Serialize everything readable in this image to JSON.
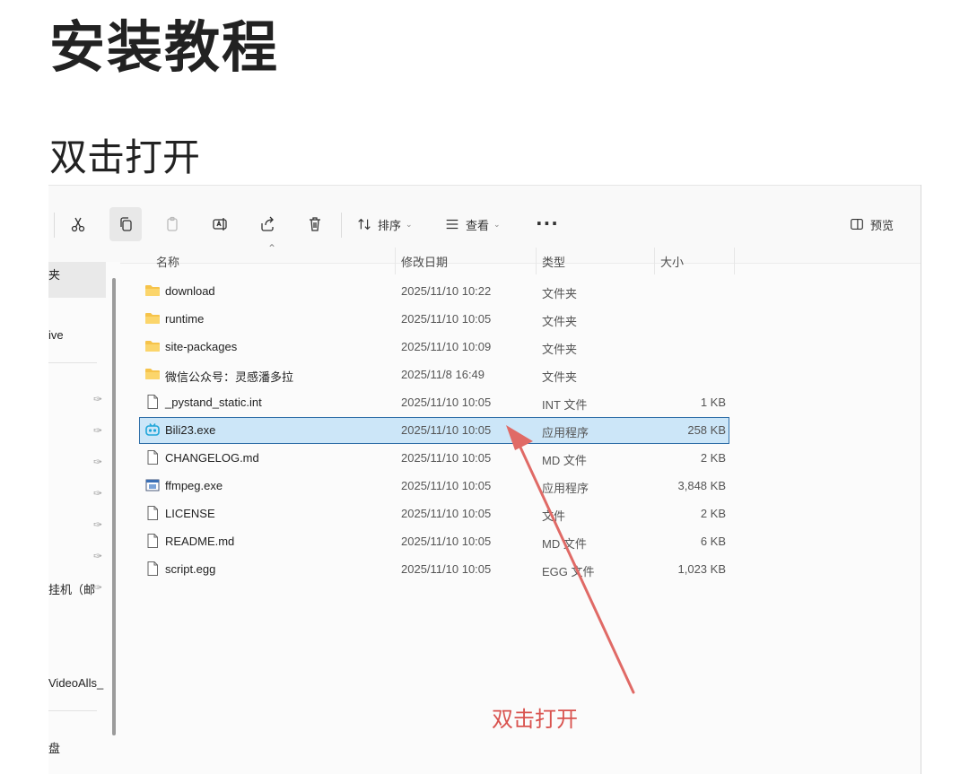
{
  "page": {
    "title": "安装教程",
    "section": "双击打开"
  },
  "toolbar": {
    "sort_label": "排序",
    "view_label": "查看",
    "more_label": "···",
    "preview_label": "预览",
    "icons": [
      "cut-icon",
      "copy-icon",
      "paste-icon",
      "rename-icon",
      "share-icon",
      "delete-icon"
    ]
  },
  "nav": {
    "items": [
      "夹",
      "ive",
      "挂机（邮",
      "VideoAlls_",
      "盘"
    ]
  },
  "columns": {
    "name": "名称",
    "date": "修改日期",
    "type": "类型",
    "size": "大小"
  },
  "files": [
    {
      "name": "download",
      "date": "2025/11/10 10:22",
      "type": "文件夹",
      "size": "",
      "kind": "folder"
    },
    {
      "name": "runtime",
      "date": "2025/11/10 10:05",
      "type": "文件夹",
      "size": "",
      "kind": "folder"
    },
    {
      "name": "site-packages",
      "date": "2025/11/10 10:09",
      "type": "文件夹",
      "size": "",
      "kind": "folder"
    },
    {
      "name": "微信公众号：灵感潘多拉",
      "date": "2025/11/8 16:49",
      "type": "文件夹",
      "size": "",
      "kind": "folder"
    },
    {
      "name": "_pystand_static.int",
      "date": "2025/11/10 10:05",
      "type": "INT 文件",
      "size": "1 KB",
      "kind": "file"
    },
    {
      "name": "Bili23.exe",
      "date": "2025/11/10 10:05",
      "type": "应用程序",
      "size": "258 KB",
      "kind": "bili",
      "selected": true
    },
    {
      "name": "CHANGELOG.md",
      "date": "2025/11/10 10:05",
      "type": "MD 文件",
      "size": "2 KB",
      "kind": "file"
    },
    {
      "name": "ffmpeg.exe",
      "date": "2025/11/10 10:05",
      "type": "应用程序",
      "size": "3,848 KB",
      "kind": "exe"
    },
    {
      "name": "LICENSE",
      "date": "2025/11/10 10:05",
      "type": "文件",
      "size": "2 KB",
      "kind": "file"
    },
    {
      "name": "README.md",
      "date": "2025/11/10 10:05",
      "type": "MD 文件",
      "size": "6 KB",
      "kind": "file"
    },
    {
      "name": "script.egg",
      "date": "2025/11/10 10:05",
      "type": "EGG 文件",
      "size": "1,023 KB",
      "kind": "file"
    }
  ],
  "annotation": {
    "text": "双击打开",
    "color": "#d9534f"
  }
}
